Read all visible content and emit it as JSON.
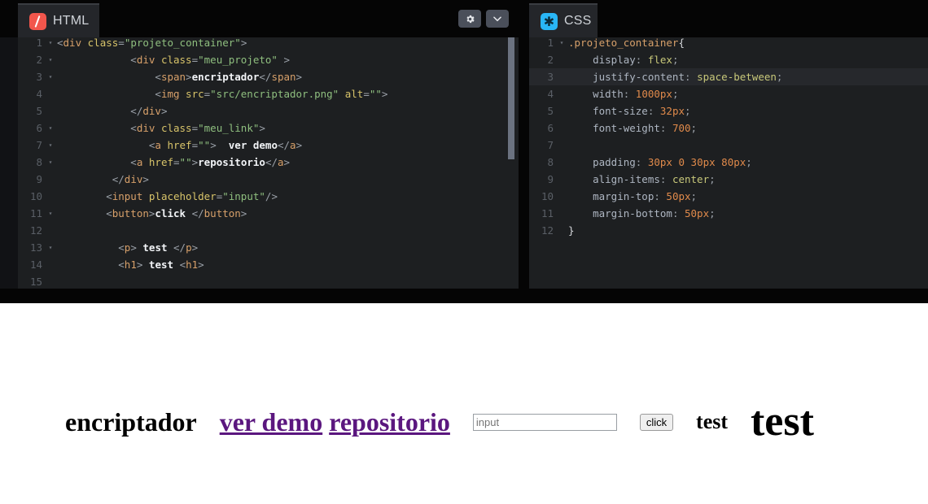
{
  "panels": {
    "html": {
      "tab_label": "HTML",
      "tab_icon": "html5-slash-icon",
      "toolbar": {
        "settings_icon": "gear-icon",
        "collapse_icon": "chevron-down-icon"
      },
      "lines": [
        {
          "n": "1",
          "fold": "▾",
          "tokens": [
            {
              "c": "t-punc",
              "t": "<"
            },
            {
              "c": "t-tag",
              "t": "div"
            },
            {
              "c": "t-punc",
              "t": " "
            },
            {
              "c": "t-attr",
              "t": "class"
            },
            {
              "c": "t-punc",
              "t": "="
            },
            {
              "c": "t-str",
              "t": "\"projeto_container\""
            },
            {
              "c": "t-punc",
              "t": ">"
            }
          ]
        },
        {
          "n": "2",
          "fold": "▾",
          "tokens": [
            {
              "c": "t-punc",
              "t": "            <"
            },
            {
              "c": "t-tag",
              "t": "div"
            },
            {
              "c": "t-punc",
              "t": " "
            },
            {
              "c": "t-attr",
              "t": "class"
            },
            {
              "c": "t-punc",
              "t": "="
            },
            {
              "c": "t-str",
              "t": "\"meu_projeto\""
            },
            {
              "c": "t-punc",
              "t": " >"
            }
          ]
        },
        {
          "n": "3",
          "fold": "▾",
          "tokens": [
            {
              "c": "t-punc",
              "t": "                <"
            },
            {
              "c": "t-tag",
              "t": "span"
            },
            {
              "c": "t-punc",
              "t": ">"
            },
            {
              "c": "t-txt",
              "t": "encriptador"
            },
            {
              "c": "t-punc",
              "t": "</"
            },
            {
              "c": "t-tag",
              "t": "span"
            },
            {
              "c": "t-punc",
              "t": ">"
            }
          ]
        },
        {
          "n": "4",
          "fold": "",
          "tokens": [
            {
              "c": "t-punc",
              "t": "                <"
            },
            {
              "c": "t-tag",
              "t": "img"
            },
            {
              "c": "t-punc",
              "t": " "
            },
            {
              "c": "t-attr",
              "t": "src"
            },
            {
              "c": "t-punc",
              "t": "="
            },
            {
              "c": "t-str",
              "t": "\"src/encriptador.png\""
            },
            {
              "c": "t-punc",
              "t": " "
            },
            {
              "c": "t-attr",
              "t": "alt"
            },
            {
              "c": "t-punc",
              "t": "="
            },
            {
              "c": "t-str",
              "t": "\"\""
            },
            {
              "c": "t-punc",
              "t": ">"
            }
          ]
        },
        {
          "n": "5",
          "fold": "",
          "tokens": [
            {
              "c": "t-punc",
              "t": "            </"
            },
            {
              "c": "t-tag",
              "t": "div"
            },
            {
              "c": "t-punc",
              "t": ">"
            }
          ]
        },
        {
          "n": "6",
          "fold": "▾",
          "tokens": [
            {
              "c": "t-punc",
              "t": "            <"
            },
            {
              "c": "t-tag",
              "t": "div"
            },
            {
              "c": "t-punc",
              "t": " "
            },
            {
              "c": "t-attr",
              "t": "class"
            },
            {
              "c": "t-punc",
              "t": "="
            },
            {
              "c": "t-str",
              "t": "\"meu_link\""
            },
            {
              "c": "t-punc",
              "t": ">"
            }
          ]
        },
        {
          "n": "7",
          "fold": "▾",
          "tokens": [
            {
              "c": "t-punc",
              "t": "               <"
            },
            {
              "c": "t-tag",
              "t": "a"
            },
            {
              "c": "t-punc",
              "t": " "
            },
            {
              "c": "t-attr",
              "t": "href"
            },
            {
              "c": "t-punc",
              "t": "="
            },
            {
              "c": "t-str",
              "t": "\"\""
            },
            {
              "c": "t-punc",
              "t": ">  "
            },
            {
              "c": "t-txt",
              "t": "ver demo"
            },
            {
              "c": "t-punc",
              "t": "</"
            },
            {
              "c": "t-tag",
              "t": "a"
            },
            {
              "c": "t-punc",
              "t": ">"
            }
          ]
        },
        {
          "n": "8",
          "fold": "▾",
          "tokens": [
            {
              "c": "t-punc",
              "t": "            <"
            },
            {
              "c": "t-tag",
              "t": "a"
            },
            {
              "c": "t-punc",
              "t": " "
            },
            {
              "c": "t-attr",
              "t": "href"
            },
            {
              "c": "t-punc",
              "t": "="
            },
            {
              "c": "t-str",
              "t": "\"\""
            },
            {
              "c": "t-punc",
              "t": ">"
            },
            {
              "c": "t-txt",
              "t": "repositorio"
            },
            {
              "c": "t-punc",
              "t": "</"
            },
            {
              "c": "t-tag",
              "t": "a"
            },
            {
              "c": "t-punc",
              "t": ">"
            }
          ]
        },
        {
          "n": "9",
          "fold": "",
          "tokens": [
            {
              "c": "t-punc",
              "t": "         </"
            },
            {
              "c": "t-tag",
              "t": "div"
            },
            {
              "c": "t-punc",
              "t": ">"
            }
          ]
        },
        {
          "n": "10",
          "fold": "",
          "tokens": [
            {
              "c": "t-punc",
              "t": "        <"
            },
            {
              "c": "t-tag",
              "t": "input"
            },
            {
              "c": "t-punc",
              "t": " "
            },
            {
              "c": "t-attr",
              "t": "placeholder"
            },
            {
              "c": "t-punc",
              "t": "="
            },
            {
              "c": "t-str",
              "t": "\"input\""
            },
            {
              "c": "t-punc",
              "t": "/>"
            }
          ]
        },
        {
          "n": "11",
          "fold": "▾",
          "tokens": [
            {
              "c": "t-punc",
              "t": "        <"
            },
            {
              "c": "t-tag",
              "t": "button"
            },
            {
              "c": "t-punc",
              "t": ">"
            },
            {
              "c": "t-txt",
              "t": "click "
            },
            {
              "c": "t-punc",
              "t": "</"
            },
            {
              "c": "t-tag",
              "t": "button"
            },
            {
              "c": "t-punc",
              "t": ">"
            }
          ]
        },
        {
          "n": "12",
          "fold": "",
          "tokens": [
            {
              "c": "t-punc",
              "t": ""
            }
          ]
        },
        {
          "n": "13",
          "fold": "▾",
          "tokens": [
            {
              "c": "t-punc",
              "t": "          <"
            },
            {
              "c": "t-tag",
              "t": "p"
            },
            {
              "c": "t-punc",
              "t": "> "
            },
            {
              "c": "t-txt",
              "t": "test "
            },
            {
              "c": "t-punc",
              "t": "</"
            },
            {
              "c": "t-tag",
              "t": "p"
            },
            {
              "c": "t-punc",
              "t": ">"
            }
          ]
        },
        {
          "n": "14",
          "fold": "",
          "tokens": [
            {
              "c": "t-punc",
              "t": "          <"
            },
            {
              "c": "t-tag",
              "t": "h1"
            },
            {
              "c": "t-punc",
              "t": "> "
            },
            {
              "c": "t-txt",
              "t": "test "
            },
            {
              "c": "t-punc",
              "t": "<"
            },
            {
              "c": "t-tag",
              "t": "h1"
            },
            {
              "c": "t-punc",
              "t": ">"
            }
          ]
        },
        {
          "n": "15",
          "fold": "",
          "tokens": [
            {
              "c": "t-punc",
              "t": ""
            }
          ]
        }
      ]
    },
    "css": {
      "tab_label": "CSS",
      "tab_icon": "css-asterisk-icon",
      "lines": [
        {
          "n": "1",
          "fold": "▾",
          "hl": false,
          "tokens": [
            {
              "c": "t-sel",
              "t": ".projeto_container"
            },
            {
              "c": "t-brace",
              "t": "{"
            }
          ]
        },
        {
          "n": "2",
          "fold": "",
          "hl": false,
          "tokens": [
            {
              "c": "t-prop",
              "t": "    display"
            },
            {
              "c": "t-punc",
              "t": ": "
            },
            {
              "c": "t-val",
              "t": "flex"
            },
            {
              "c": "t-punc",
              "t": ";"
            }
          ]
        },
        {
          "n": "3",
          "fold": "",
          "hl": true,
          "tokens": [
            {
              "c": "t-prop",
              "t": "    justify-content"
            },
            {
              "c": "t-punc",
              "t": ": "
            },
            {
              "c": "t-val",
              "t": "space-between"
            },
            {
              "c": "t-punc",
              "t": ";"
            }
          ]
        },
        {
          "n": "4",
          "fold": "",
          "hl": false,
          "tokens": [
            {
              "c": "t-prop",
              "t": "    width"
            },
            {
              "c": "t-punc",
              "t": ": "
            },
            {
              "c": "t-num",
              "t": "1000px"
            },
            {
              "c": "t-punc",
              "t": ";"
            }
          ]
        },
        {
          "n": "5",
          "fold": "",
          "hl": false,
          "tokens": [
            {
              "c": "t-prop",
              "t": "    font-size"
            },
            {
              "c": "t-punc",
              "t": ": "
            },
            {
              "c": "t-num",
              "t": "32px"
            },
            {
              "c": "t-punc",
              "t": ";"
            }
          ]
        },
        {
          "n": "6",
          "fold": "",
          "hl": false,
          "tokens": [
            {
              "c": "t-prop",
              "t": "    font-weight"
            },
            {
              "c": "t-punc",
              "t": ": "
            },
            {
              "c": "t-num",
              "t": "700"
            },
            {
              "c": "t-punc",
              "t": ";"
            }
          ]
        },
        {
          "n": "7",
          "fold": "",
          "hl": false,
          "tokens": [
            {
              "c": "t-punc",
              "t": ""
            }
          ]
        },
        {
          "n": "8",
          "fold": "",
          "hl": false,
          "tokens": [
            {
              "c": "t-prop",
              "t": "    padding"
            },
            {
              "c": "t-punc",
              "t": ": "
            },
            {
              "c": "t-num",
              "t": "30px 0 30px 80px"
            },
            {
              "c": "t-punc",
              "t": ";"
            }
          ]
        },
        {
          "n": "9",
          "fold": "",
          "hl": false,
          "tokens": [
            {
              "c": "t-prop",
              "t": "    align-items"
            },
            {
              "c": "t-punc",
              "t": ": "
            },
            {
              "c": "t-val",
              "t": "center"
            },
            {
              "c": "t-punc",
              "t": ";"
            }
          ]
        },
        {
          "n": "10",
          "fold": "",
          "hl": false,
          "tokens": [
            {
              "c": "t-prop",
              "t": "    margin-top"
            },
            {
              "c": "t-punc",
              "t": ": "
            },
            {
              "c": "t-num",
              "t": "50px"
            },
            {
              "c": "t-punc",
              "t": ";"
            }
          ]
        },
        {
          "n": "11",
          "fold": "",
          "hl": false,
          "tokens": [
            {
              "c": "t-prop",
              "t": "    margin-bottom"
            },
            {
              "c": "t-punc",
              "t": ": "
            },
            {
              "c": "t-num",
              "t": "50px"
            },
            {
              "c": "t-punc",
              "t": ";"
            }
          ]
        },
        {
          "n": "12",
          "fold": "",
          "hl": false,
          "tokens": [
            {
              "c": "t-brace",
              "t": "}"
            }
          ]
        }
      ]
    }
  },
  "preview": {
    "projeto_label": "encriptador",
    "link_demo": "ver demo",
    "link_repo": "repositorio",
    "input_placeholder": "input",
    "input_value": "",
    "button_label": "click",
    "paragraph_text": "test",
    "heading_text": "test"
  },
  "colors": {
    "editor_bg": "#1d1f21",
    "page_bg": "#050505",
    "tab_bg": "#24262a",
    "html_accent": "#f2564c",
    "css_accent": "#29b6f6",
    "link_purple": "#5b177f",
    "scrollbar": "#6b7280"
  }
}
